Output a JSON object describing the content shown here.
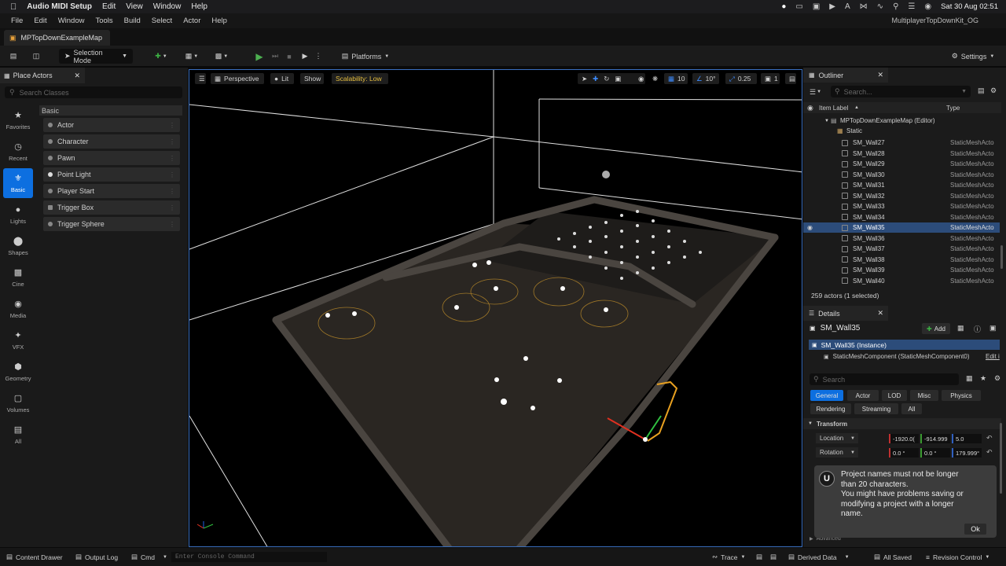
{
  "macbar": {
    "app_name": "Audio MIDI Setup",
    "menus": [
      "Edit",
      "View",
      "Window",
      "Help"
    ],
    "datetime": "Sat 30 Aug  02:51"
  },
  "menubar": {
    "items": [
      "File",
      "Edit",
      "Window",
      "Tools",
      "Build",
      "Select",
      "Actor",
      "Help"
    ],
    "project": "MultiplayerTopDownKit_OG"
  },
  "tab": {
    "label": "MPTopDownExampleMap"
  },
  "toolbar": {
    "selection_mode": "Selection Mode",
    "platforms": "Platforms",
    "settings": "Settings"
  },
  "place_actors": {
    "title": "Place Actors",
    "search_placeholder": "Search Classes",
    "categories": [
      {
        "label": "Favorites",
        "icon": "star-icon"
      },
      {
        "label": "Recent",
        "icon": "clock-icon"
      },
      {
        "label": "Basic",
        "icon": "basic-icon",
        "active": true
      },
      {
        "label": "Lights",
        "icon": "bulb-icon"
      },
      {
        "label": "Shapes",
        "icon": "shapes-icon"
      },
      {
        "label": "Cine",
        "icon": "clapper-icon"
      },
      {
        "label": "Media",
        "icon": "media-icon"
      },
      {
        "label": "VFX",
        "icon": "vfx-icon"
      },
      {
        "label": "Geometry",
        "icon": "geometry-icon"
      },
      {
        "label": "Volumes",
        "icon": "volume-icon"
      },
      {
        "label": "All",
        "icon": "all-icon"
      }
    ],
    "section": "Basic",
    "actors": [
      "Actor",
      "Character",
      "Pawn",
      "Point Light",
      "Player Start",
      "Trigger Box",
      "Trigger Sphere"
    ]
  },
  "viewport": {
    "perspective": "Perspective",
    "lit": "Lit",
    "show": "Show",
    "scalability": "Scalability: Low",
    "grid_size": "10",
    "angle": "10°",
    "scale": "0.25",
    "camera": "1"
  },
  "outliner": {
    "title": "Outliner",
    "search_placeholder": "Search...",
    "col_label": "Item Label",
    "col_type": "Type",
    "map": "MPTopDownExampleMap (Editor)",
    "folder": "Static",
    "rows": [
      {
        "label": "SM_Wall27",
        "type": "StaticMeshActo"
      },
      {
        "label": "SM_Wall28",
        "type": "StaticMeshActo"
      },
      {
        "label": "SM_Wall29",
        "type": "StaticMeshActo"
      },
      {
        "label": "SM_Wall30",
        "type": "StaticMeshActo"
      },
      {
        "label": "SM_Wall31",
        "type": "StaticMeshActo"
      },
      {
        "label": "SM_Wall32",
        "type": "StaticMeshActo"
      },
      {
        "label": "SM_Wall33",
        "type": "StaticMeshActo"
      },
      {
        "label": "SM_Wall34",
        "type": "StaticMeshActo"
      },
      {
        "label": "SM_Wall35",
        "type": "StaticMeshActo",
        "selected": true
      },
      {
        "label": "SM_Wall36",
        "type": "StaticMeshActo"
      },
      {
        "label": "SM_Wall37",
        "type": "StaticMeshActo"
      },
      {
        "label": "SM_Wall38",
        "type": "StaticMeshActo"
      },
      {
        "label": "SM_Wall39",
        "type": "StaticMeshActo"
      },
      {
        "label": "SM_Wall40",
        "type": "StaticMeshActo"
      }
    ],
    "count": "259 actors (1 selected)"
  },
  "details": {
    "title": "Details",
    "name": "SM_Wall35",
    "add": "Add",
    "instance": "SM_Wall35 (Instance)",
    "component": "StaticMeshComponent (StaticMeshComponent0)",
    "edit": "Edit i",
    "search_placeholder": "Search",
    "tabs_row1": [
      "General",
      "Actor",
      "LOD",
      "Misc",
      "Physics"
    ],
    "tabs_row2": [
      "Rendering",
      "Streaming",
      "All"
    ],
    "section": "Transform",
    "location_label": "Location",
    "location": [
      "-1920.0(",
      "-914.999",
      "5.0"
    ],
    "rotation_label": "Rotation",
    "rotation": [
      "0.0 °",
      "0.0 °",
      "179.999°"
    ],
    "advanced": "Advanced"
  },
  "toast": {
    "message_line1": "Project names must not be longer",
    "message_line2": "than 20 characters.",
    "message_line3": "You might have problems saving or",
    "message_line4": "modifying a project with a longer",
    "message_line5": "name.",
    "ok": "Ok"
  },
  "statusbar": {
    "content_drawer": "Content Drawer",
    "output_log": "Output Log",
    "cmd": "Cmd",
    "console_placeholder": "Enter Console Command",
    "trace": "Trace",
    "derived_data": "Derived Data",
    "all_saved": "All Saved",
    "revision_control": "Revision Control"
  },
  "colors": {
    "accent": "#0d6fe0",
    "selected_row": "#2c4c7a",
    "general_tab": "#0d6fe0",
    "scalability": "#e8c040"
  }
}
